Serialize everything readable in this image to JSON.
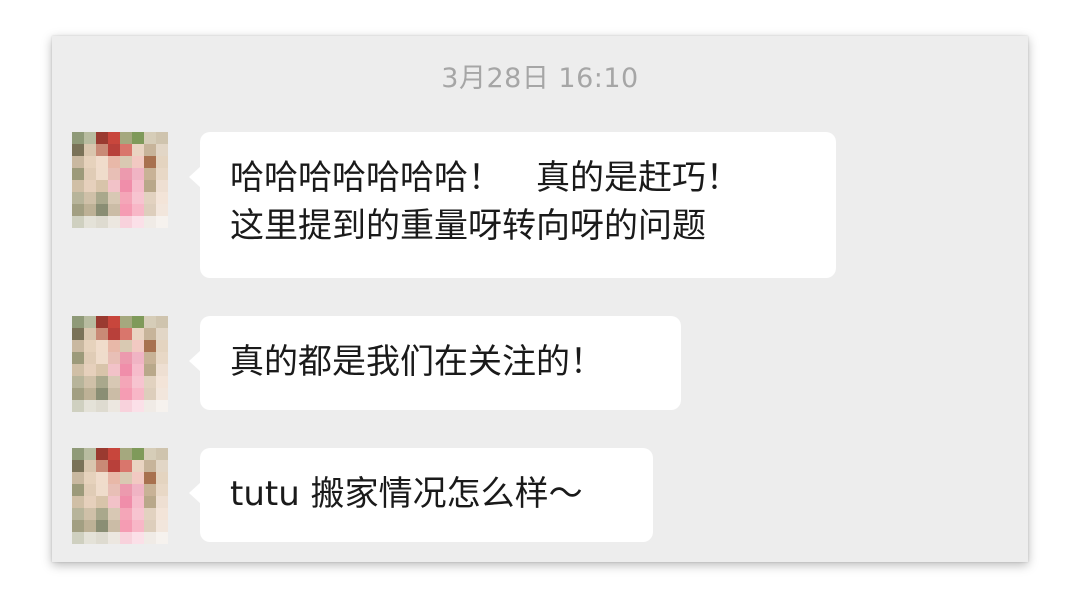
{
  "chat": {
    "timestamp": "3月28日 16:10",
    "messages": [
      {
        "avatar_icon": "user-avatar-pixelated",
        "lines": [
          "哈哈哈哈哈哈哈！　真的是赶巧！",
          "这里提到的重量呀转向呀的问题"
        ]
      },
      {
        "avatar_icon": "user-avatar-pixelated",
        "lines": [
          "真的都是我们在关注的！"
        ]
      },
      {
        "avatar_icon": "user-avatar-pixelated",
        "lines": [
          "tutu 搬家情况怎么样～"
        ]
      }
    ]
  },
  "colors": {
    "background": "#ededed",
    "bubble": "#ffffff",
    "timestamp_text": "#a6a6a6",
    "message_text": "#1a1a1a"
  }
}
